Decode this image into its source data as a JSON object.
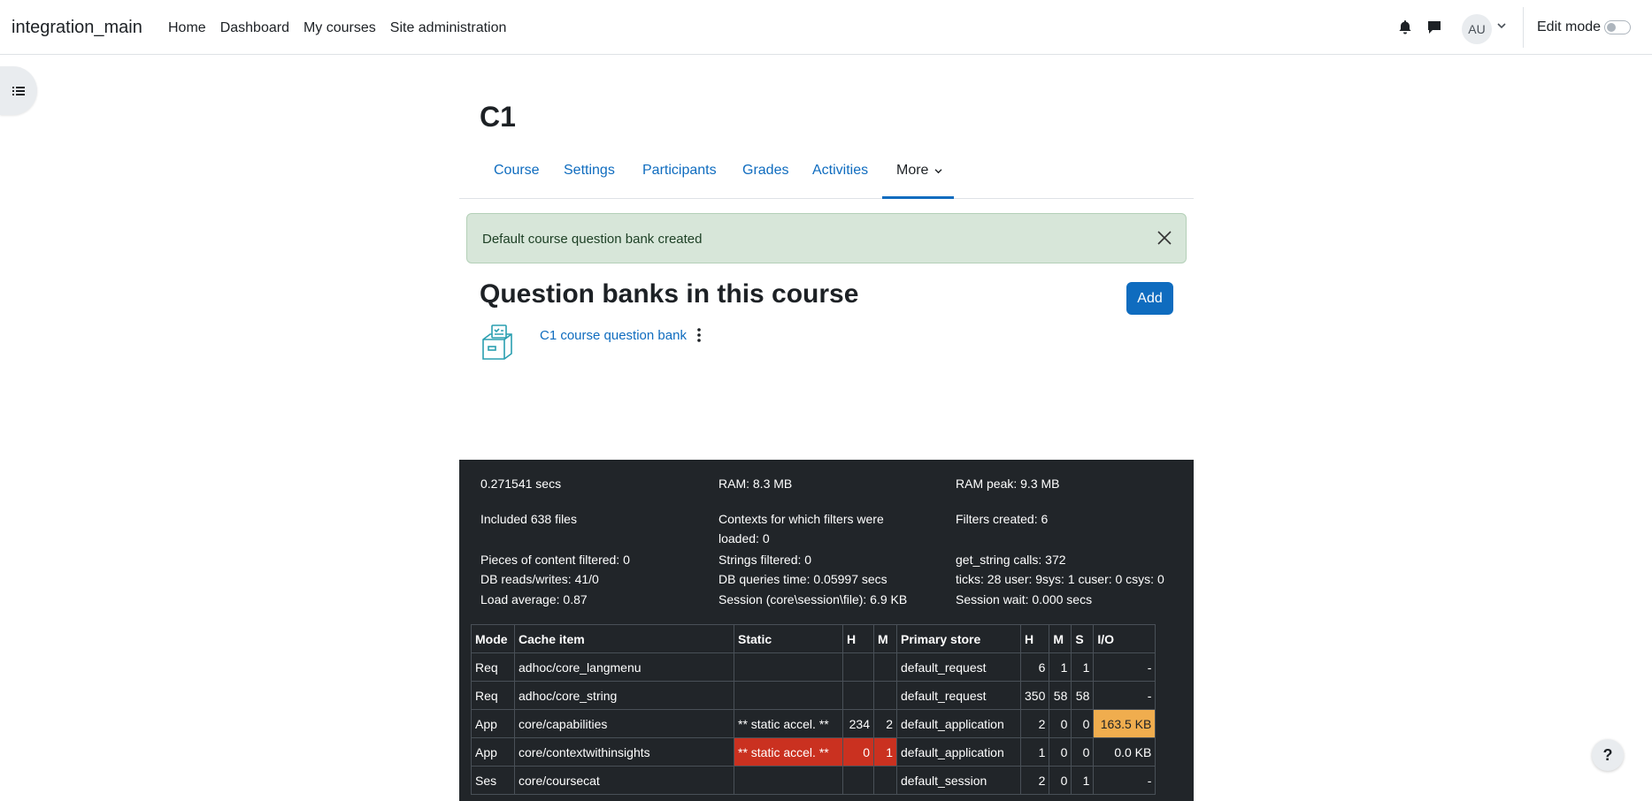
{
  "navbar": {
    "brand": "integration_main",
    "links": [
      "Home",
      "Dashboard",
      "My courses",
      "Site administration"
    ],
    "avatar_initials": "AU",
    "edit_mode_label": "Edit mode",
    "edit_mode_on": false
  },
  "course": {
    "title": "C1",
    "tabs": [
      "Course",
      "Settings",
      "Participants",
      "Grades",
      "Activities",
      "More"
    ]
  },
  "alert": {
    "message": "Default course question bank created"
  },
  "main": {
    "heading": "Question banks in this course",
    "add_label": "Add",
    "banks": [
      {
        "name": "C1 course question bank"
      }
    ]
  },
  "perf": {
    "stats": [
      "0.271541 secs",
      "RAM: 8.3 MB",
      "RAM peak: 9.3 MB",
      "Included 638 files",
      "Contexts for which filters were loaded: 0",
      "Filters created: 6",
      "Pieces of content filtered: 0",
      "Strings filtered: 0",
      "get_string calls: 372",
      "DB reads/writes: 41/0",
      "DB queries time: 0.05997 secs",
      "ticks: 28 user: 9sys: 1 cuser: 0 csys: 0",
      "Load average: 0.87",
      "Session (core\\session\\file): 6.9 KB",
      "Session wait: 0.000 secs"
    ],
    "cache_headers": [
      "Mode",
      "Cache item",
      "Static",
      "H",
      "M",
      "Primary store",
      "H",
      "M",
      "S",
      "I/O"
    ],
    "cache_rows": [
      [
        "Req",
        "adhoc/core_langmenu",
        "",
        "",
        "",
        "default_request",
        "6",
        "1",
        "1",
        "-"
      ],
      [
        "Req",
        "adhoc/core_string",
        "",
        "",
        "",
        "default_request",
        "350",
        "58",
        "58",
        "-"
      ],
      [
        "App",
        "core/capabilities",
        "** static accel. **",
        "234",
        "2",
        "default_application",
        "2",
        "0",
        "0",
        "163.5 KB"
      ],
      [
        "App",
        "core/contextwithinsights",
        "** static accel. **",
        "0",
        "1",
        "default_application",
        "1",
        "0",
        "0",
        "0.0 KB"
      ],
      [
        "Ses",
        "core/coursecat",
        "",
        "",
        "",
        "default_session",
        "2",
        "0",
        "1",
        "-"
      ]
    ]
  },
  "colors": {
    "accent": "#0f6cbf",
    "alert_bg": "#d7e6d9",
    "perf_bg": "#212529",
    "miss_red": "#ca3120",
    "io_orange": "#f0ad4e"
  },
  "help_label": "?"
}
